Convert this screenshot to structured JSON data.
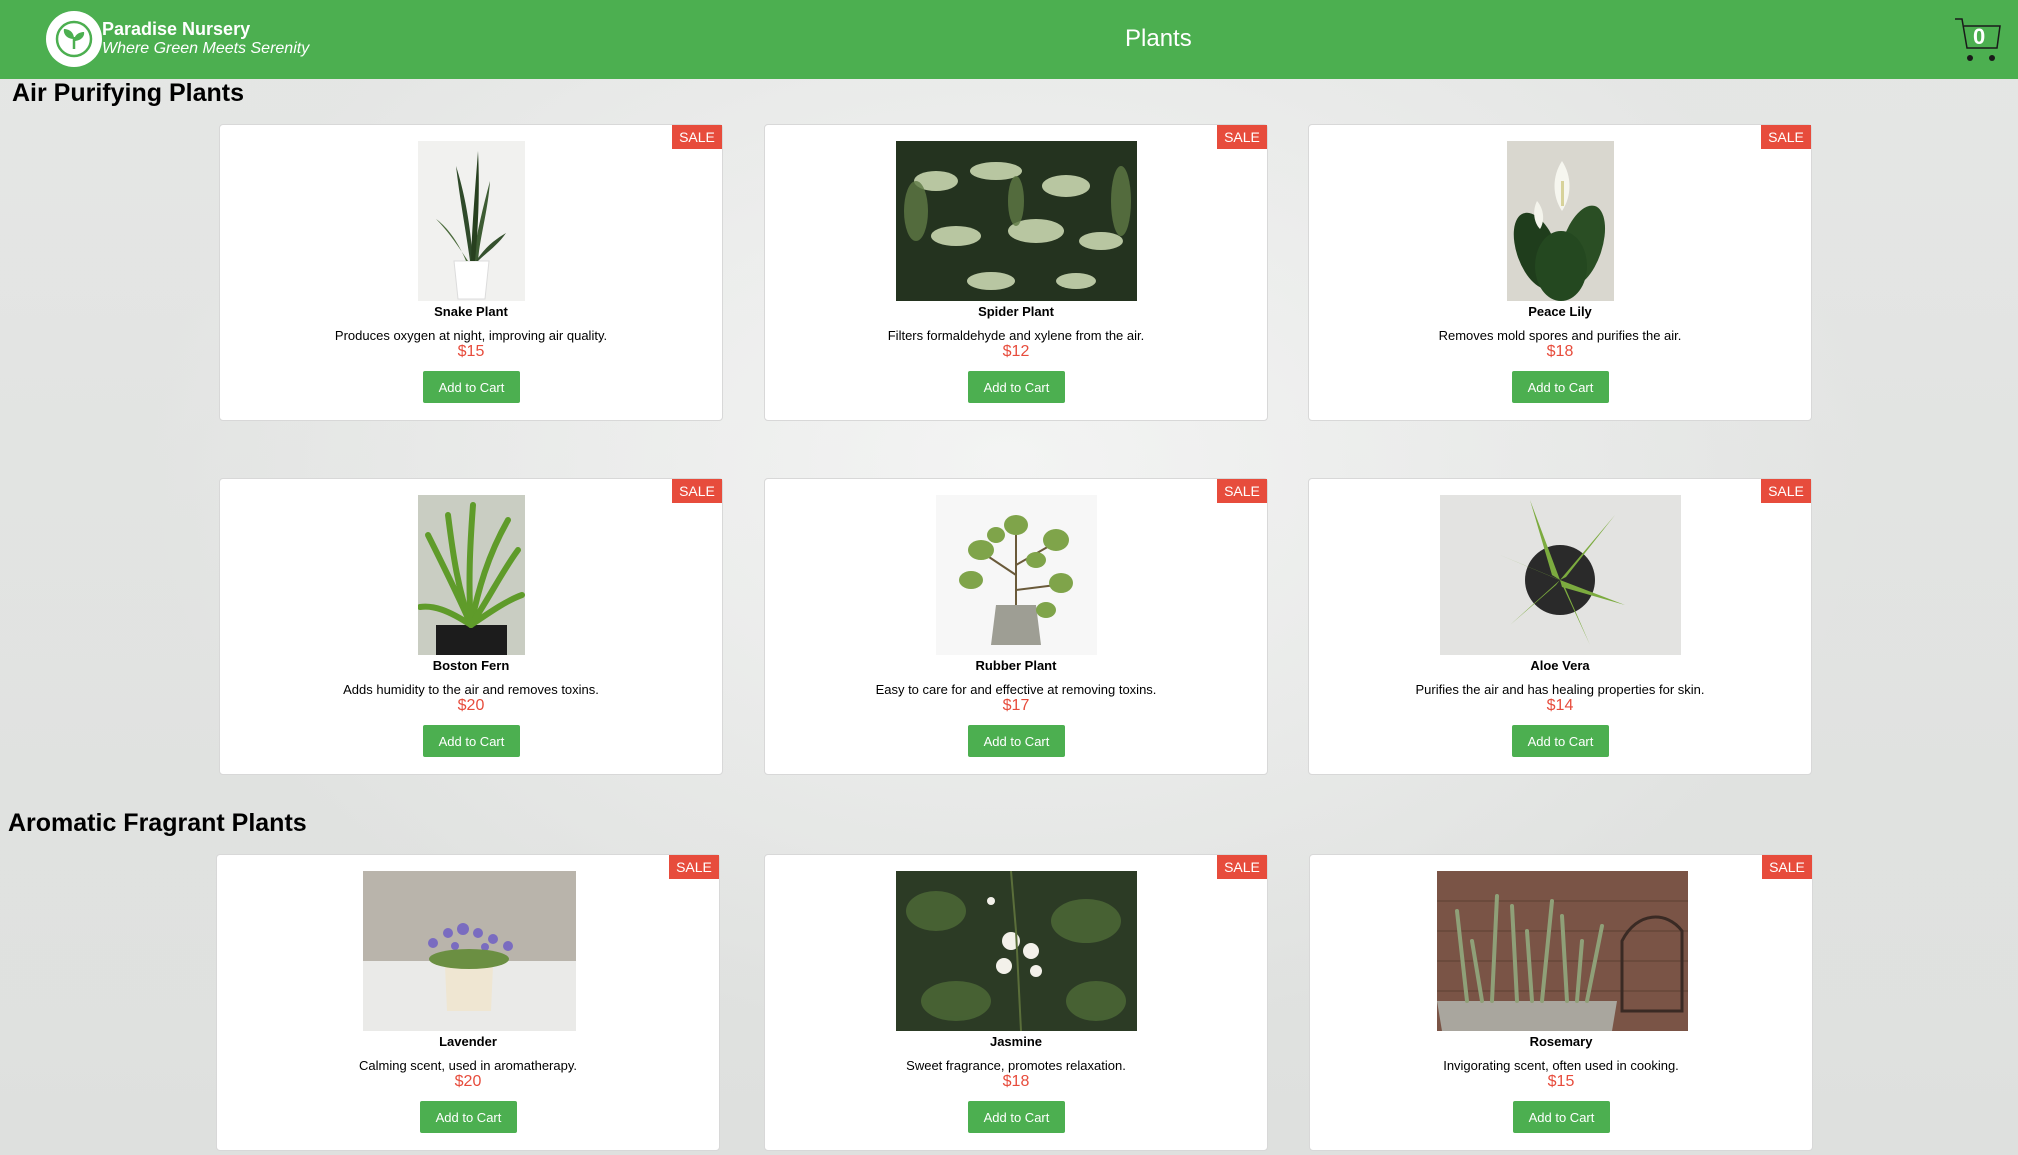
{
  "header": {
    "brand": "Paradise Nursery",
    "tagline": "Where Green Meets Serenity",
    "title": "Plants",
    "cart_count": "0"
  },
  "sections": [
    {
      "title": "Air Purifying Plants",
      "plants": [
        {
          "name": "Snake Plant",
          "description": "Produces oxygen at night, improving air quality.",
          "price": "$15",
          "badge": "SALE",
          "button": "Add to Cart"
        },
        {
          "name": "Spider Plant",
          "description": "Filters formaldehyde and xylene from the air.",
          "price": "$12",
          "badge": "SALE",
          "button": "Add to Cart"
        },
        {
          "name": "Peace Lily",
          "description": "Removes mold spores and purifies the air.",
          "price": "$18",
          "badge": "SALE",
          "button": "Add to Cart"
        },
        {
          "name": "Boston Fern",
          "description": "Adds humidity to the air and removes toxins.",
          "price": "$20",
          "badge": "SALE",
          "button": "Add to Cart"
        },
        {
          "name": "Rubber Plant",
          "description": "Easy to care for and effective at removing toxins.",
          "price": "$17",
          "badge": "SALE",
          "button": "Add to Cart"
        },
        {
          "name": "Aloe Vera",
          "description": "Purifies the air and has healing properties for skin.",
          "price": "$14",
          "badge": "SALE",
          "button": "Add to Cart"
        }
      ]
    },
    {
      "title": "Aromatic Fragrant Plants",
      "plants": [
        {
          "name": "Lavender",
          "description": "Calming scent, used in aromatherapy.",
          "price": "$20",
          "badge": "SALE",
          "button": "Add to Cart"
        },
        {
          "name": "Jasmine",
          "description": "Sweet fragrance, promotes relaxation.",
          "price": "$18",
          "badge": "SALE",
          "button": "Add to Cart"
        },
        {
          "name": "Rosemary",
          "description": "Invigorating scent, often used in cooking.",
          "price": "$15",
          "badge": "SALE",
          "button": "Add to Cart"
        }
      ]
    }
  ],
  "colors": {
    "navbar": "#4caf50",
    "sale_badge": "#e74c3c",
    "price": "#e74c3c",
    "button": "#4caf50"
  }
}
